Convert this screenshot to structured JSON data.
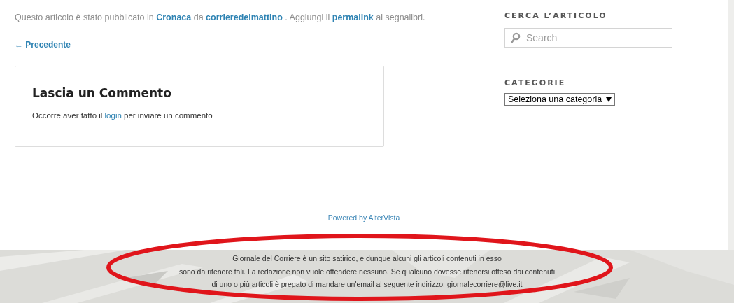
{
  "entry_meta": [
    {
      "kind": "text",
      "text": "Questo articolo è stato pubblicato in "
    },
    {
      "kind": "link",
      "text": "Cronaca"
    },
    {
      "kind": "text",
      "text": " da "
    },
    {
      "kind": "link",
      "text": "corrieredelmattino"
    },
    {
      "kind": "text",
      "text": " . Aggiungi il "
    },
    {
      "kind": "link",
      "text": "permalink"
    },
    {
      "kind": "text",
      "text": " ai segnalibri."
    }
  ],
  "nav_previous": {
    "arrow": "←",
    "label": "Precedente"
  },
  "comments": {
    "title": "Lascia un Commento",
    "note": [
      {
        "kind": "text",
        "text": "Occorre aver fatto il "
      },
      {
        "kind": "link",
        "text": "login"
      },
      {
        "kind": "text",
        "text": " per inviare un commento"
      }
    ]
  },
  "sidebar": {
    "search": {
      "title": "CERCA L’ARTICOLO",
      "placeholder": "Search"
    },
    "categories": {
      "title": "CATEGORIE",
      "select": "Seleziona una categoria"
    }
  },
  "powered": "Powered by AlterVista",
  "footer": {
    "lines": [
      "Giornale del Corriere è un sito satirico, e dunque alcuni gli articoli contenuti in esso",
      "sono da ritenere tali. La redazione non vuole offendere nessuno. Se qualcuno dovesse ritenersi offeso dai contenuti",
      "di uno o più articoli è pregato di mandare un'email al seguente indirizzo: giornalecorriere@live.it"
    ],
    "annotation": {
      "kind": "ellipse",
      "color": "#e0151b"
    }
  }
}
